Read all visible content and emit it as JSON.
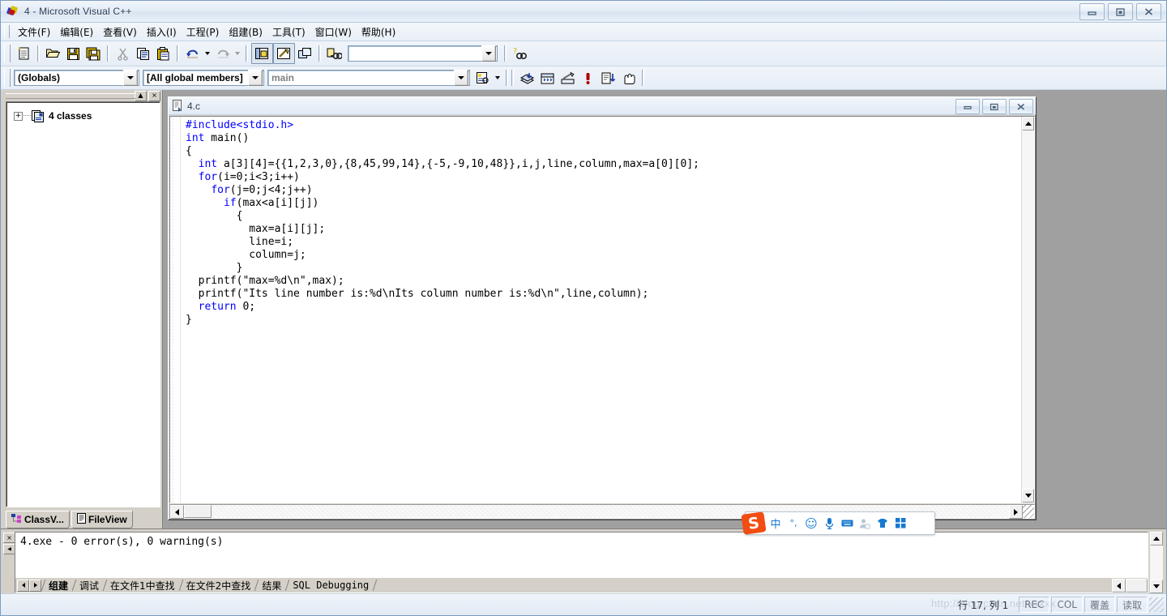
{
  "window": {
    "title": "4 - Microsoft Visual C++",
    "icon": "vcpp-logo-icon",
    "buttons": {
      "minimize": "Minimize",
      "maximize": "Maximize",
      "close": "Close"
    }
  },
  "menubar": {
    "items": [
      {
        "name": "file",
        "label": "文件(F)"
      },
      {
        "name": "edit",
        "label": "编辑(E)"
      },
      {
        "name": "view",
        "label": "查看(V)"
      },
      {
        "name": "insert",
        "label": "插入(I)"
      },
      {
        "name": "project",
        "label": "工程(P)"
      },
      {
        "name": "build",
        "label": "组建(B)"
      },
      {
        "name": "tools",
        "label": "工具(T)"
      },
      {
        "name": "window",
        "label": "窗口(W)"
      },
      {
        "name": "help",
        "label": "帮助(H)"
      }
    ]
  },
  "standard_toolbar": {
    "buttons": [
      "new-text-file-icon",
      "open-folder-icon",
      "save-icon",
      "save-all-icon",
      "cut-scissors-icon",
      "copy-icon",
      "paste-icon",
      "undo-icon",
      "redo-icon",
      "workspace-window-icon",
      "output-window-icon",
      "window-list-icon",
      "find-in-files-icon",
      "search-help-icon"
    ],
    "find_box": {
      "value": "",
      "placeholder": ""
    }
  },
  "wizardbar": {
    "scope_combo": {
      "value": "(Globals)"
    },
    "members_combo": {
      "value": "[All global members]"
    },
    "function_combo": {
      "value": "main"
    },
    "action_button": "wizardbar-action-icon",
    "build_buttons": [
      "compile-icon",
      "build-icon",
      "stop-build-icon",
      "execute-icon",
      "go-debug-icon",
      "insert-breakpoint-icon"
    ]
  },
  "workspace": {
    "tree": {
      "expander": "+",
      "icon": "classes-folder-icon",
      "label": "4 classes"
    },
    "tabs": [
      {
        "name": "classview",
        "label": "ClassV...",
        "icon": "classview-icon",
        "active": true
      },
      {
        "name": "fileview",
        "label": "FileView",
        "icon": "fileview-icon",
        "active": false
      }
    ],
    "close_button": "×",
    "minimize_button": "▲"
  },
  "editor": {
    "tab_title": "4.c",
    "tab_icon": "c-source-file-icon",
    "buttons": {
      "minimize": "Minimize",
      "restore": "Restore",
      "close": "Close"
    },
    "lines": [
      [
        {
          "t": "#include<stdio.h>",
          "c": "kw"
        }
      ],
      [
        {
          "t": "int",
          "c": "kw"
        },
        {
          "t": " main()",
          "c": ""
        }
      ],
      [
        {
          "t": "{",
          "c": ""
        }
      ],
      [
        {
          "t": "  ",
          "c": ""
        },
        {
          "t": "int",
          "c": "kw"
        },
        {
          "t": " a[3][4]={{1,2,3,0},{8,45,99,14},{-5,-9,10,48}},i,j,line,column,max=a[0][0];",
          "c": ""
        }
      ],
      [
        {
          "t": "  ",
          "c": ""
        },
        {
          "t": "for",
          "c": "kw"
        },
        {
          "t": "(i=0;i<3;i++)",
          "c": ""
        }
      ],
      [
        {
          "t": "    ",
          "c": ""
        },
        {
          "t": "for",
          "c": "kw"
        },
        {
          "t": "(j=0;j<4;j++)",
          "c": ""
        }
      ],
      [
        {
          "t": "      ",
          "c": ""
        },
        {
          "t": "if",
          "c": "kw"
        },
        {
          "t": "(max<a[i][j])",
          "c": ""
        }
      ],
      [
        {
          "t": "        {",
          "c": ""
        }
      ],
      [
        {
          "t": "          max=a[i][j];",
          "c": ""
        }
      ],
      [
        {
          "t": "          line=i;",
          "c": ""
        }
      ],
      [
        {
          "t": "          column=j;",
          "c": ""
        }
      ],
      [
        {
          "t": "        }",
          "c": ""
        }
      ],
      [
        {
          "t": "  printf(\"max=%d\\n\",max);",
          "c": ""
        }
      ],
      [
        {
          "t": "  printf(\"Its line number is:%d\\nIts column number is:%d\\n\",line,column);",
          "c": ""
        }
      ],
      [
        {
          "t": "  ",
          "c": ""
        },
        {
          "t": "return",
          "c": "kw"
        },
        {
          "t": " 0;",
          "c": ""
        }
      ],
      [
        {
          "t": "}",
          "c": ""
        }
      ]
    ]
  },
  "ime": {
    "logo": "S",
    "items": [
      {
        "name": "chinese-mode",
        "glyph": "中"
      },
      {
        "name": "punctuation-mode",
        "glyph": "°,"
      },
      {
        "name": "emoji",
        "glyph": "☺"
      },
      {
        "name": "voice-input",
        "glyph": "🎤"
      },
      {
        "name": "soft-keyboard",
        "glyph": "⌨"
      },
      {
        "name": "user-account",
        "glyph": "👤"
      },
      {
        "name": "skin",
        "glyph": "👕"
      },
      {
        "name": "toolbox",
        "glyph": "▦"
      }
    ]
  },
  "output": {
    "text": "4.exe - 0 error(s), 0 warning(s)",
    "tabs": [
      {
        "name": "build",
        "label": "组建",
        "active": true
      },
      {
        "name": "debug",
        "label": "调试",
        "active": false
      },
      {
        "name": "find-in-files-1",
        "label": "在文件1中查找",
        "active": false
      },
      {
        "name": "find-in-files-2",
        "label": "在文件2中查找",
        "active": false
      },
      {
        "name": "results",
        "label": "结果",
        "active": false
      },
      {
        "name": "sql-debugging",
        "label": "SQL Debugging",
        "active": false
      }
    ],
    "close_button": "×"
  },
  "statusbar": {
    "watermark": "http://blog.csdn.net/xxxxx",
    "position": "行 17, 列 1",
    "indicators": [
      {
        "name": "rec",
        "label": "REC"
      },
      {
        "name": "col",
        "label": "COL"
      },
      {
        "name": "overwrite",
        "label": "覆盖"
      },
      {
        "name": "readonly",
        "label": "读取"
      }
    ]
  },
  "colors": {
    "keyword": "#0000ff",
    "mdi_background": "#a0a0a0",
    "dialog_face": "#d4d0c8",
    "ime_accent": "#f24d12",
    "ime_blue": "#1878d0"
  }
}
